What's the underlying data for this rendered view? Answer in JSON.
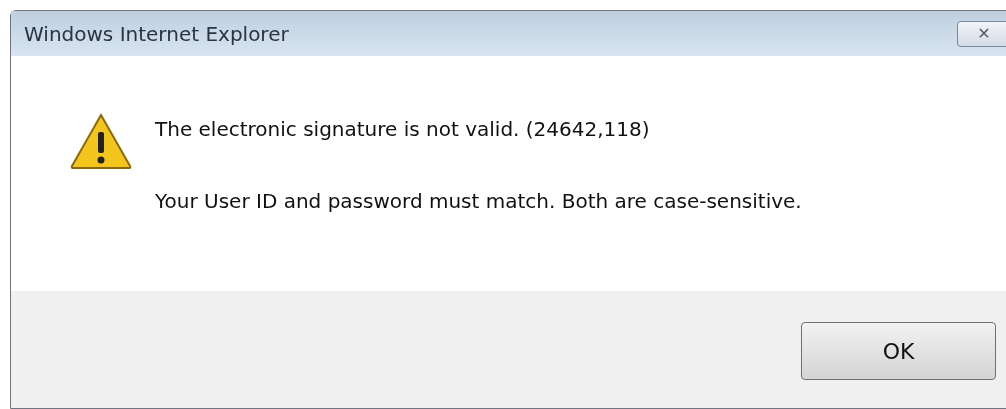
{
  "window": {
    "title": "Windows Internet Explorer",
    "close": "✕"
  },
  "messages": [
    "The electronic signature is not valid. (24642,118)",
    "Your User ID and password must match. Both are case-sensitive."
  ],
  "buttons": [
    "OK"
  ]
}
